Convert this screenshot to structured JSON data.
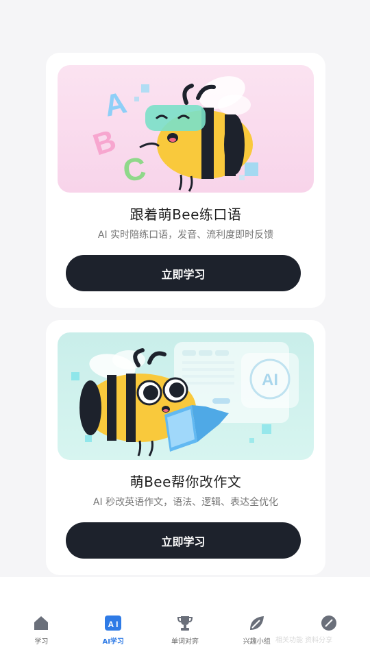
{
  "cards": [
    {
      "title": "跟着萌Bee练口语",
      "subtitle": "AI 实时陪练口语，发音、流利度即时反馈",
      "button": "立即学习",
      "banner_letters": [
        "A",
        "B",
        "C"
      ]
    },
    {
      "title": "萌Bee帮你改作文",
      "subtitle": "AI 秒改英语作文，语法、逻辑、表达全优化",
      "button": "立即学习",
      "banner_badge": "AI"
    }
  ],
  "tabbar": {
    "items": [
      {
        "label": "学习",
        "icon": "home-icon",
        "active": false
      },
      {
        "label": "AI学习",
        "icon": "ai-icon",
        "active": true
      },
      {
        "label": "单词对弈",
        "icon": "trophy-icon",
        "active": false
      },
      {
        "label": "兴趣小组",
        "icon": "leaf-icon",
        "active": false
      },
      {
        "label": "",
        "icon": "leaf-alt-icon",
        "active": false
      }
    ],
    "overlay": "相关功能 资料分享"
  },
  "colors": {
    "accent": "#2f7be6",
    "button_bg": "#1d222c",
    "bee_yellow": "#f9c93c",
    "pink_banner": "#f8d4ea",
    "mint_banner": "#c9eeea"
  }
}
